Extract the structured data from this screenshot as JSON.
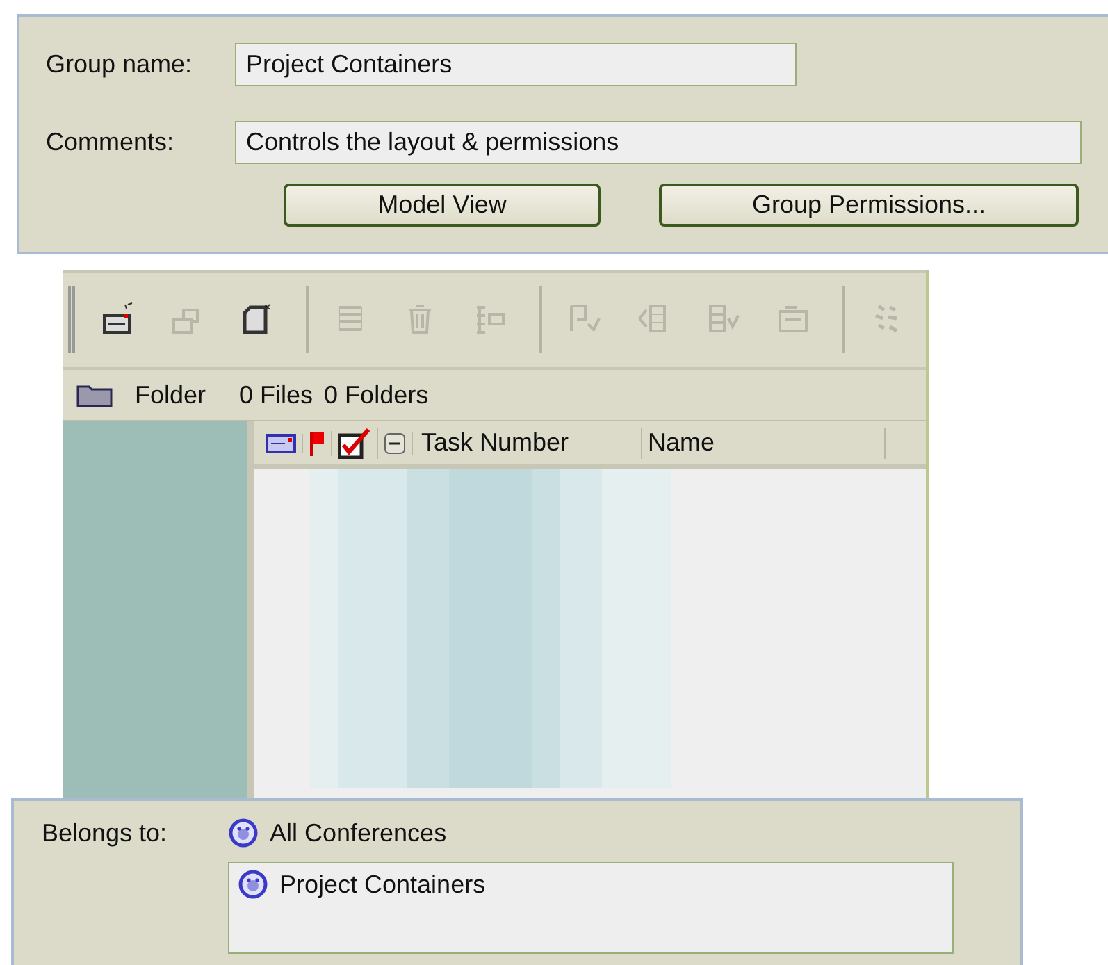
{
  "group_form": {
    "name_label": "Group name:",
    "name_value": "Project Containers",
    "comments_label": "Comments:",
    "comments_value": "Controls the layout & permissions",
    "buttons": [
      "Model View",
      "Group Permissions..."
    ]
  },
  "toolbar": [
    {
      "kind": "new-card",
      "disabled": false
    },
    {
      "kind": "link",
      "disabled": true
    },
    {
      "kind": "new-page",
      "disabled": false
    },
    {
      "kind": "sep"
    },
    {
      "kind": "list",
      "disabled": true
    },
    {
      "kind": "trash",
      "disabled": true
    },
    {
      "kind": "tree",
      "disabled": true
    },
    {
      "kind": "sep"
    },
    {
      "kind": "flag-out",
      "disabled": true
    },
    {
      "kind": "indent-left",
      "disabled": true
    },
    {
      "kind": "indent-right",
      "disabled": true
    },
    {
      "kind": "tray",
      "disabled": true
    },
    {
      "kind": "sep"
    },
    {
      "kind": "scatter",
      "disabled": true
    }
  ],
  "folder_bar": {
    "label": "Folder",
    "files": "0 Files",
    "folders": "0 Folders"
  },
  "list_header": {
    "checked": true,
    "columns": [
      "Task Number",
      "Name"
    ]
  },
  "belongs": {
    "label": "Belongs to:",
    "parent": "All Conferences",
    "items": [
      "Project Containers"
    ]
  }
}
